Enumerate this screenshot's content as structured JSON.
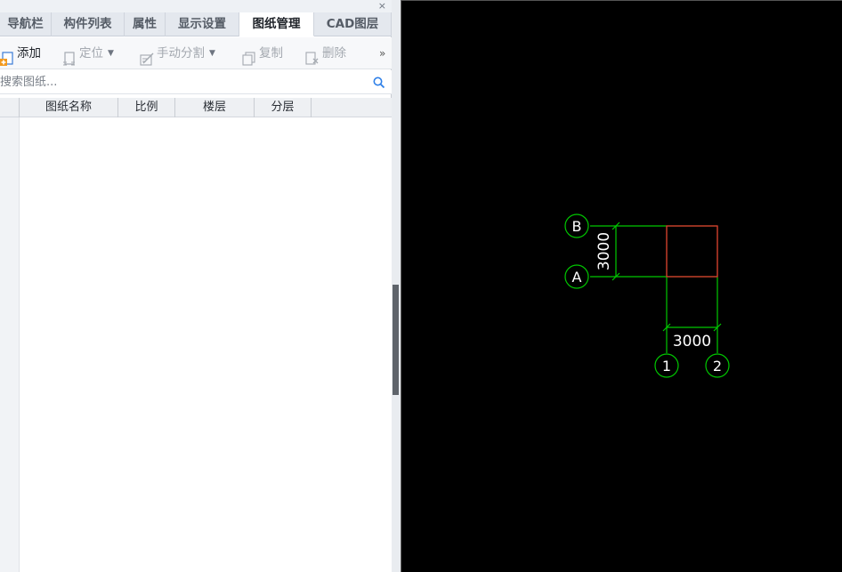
{
  "panel": {
    "close_glyph": "×",
    "tabs": [
      {
        "label": "导航栏",
        "active": false
      },
      {
        "label": "构件列表",
        "active": false
      },
      {
        "label": "属性",
        "active": false
      },
      {
        "label": "显示设置",
        "active": false
      },
      {
        "label": "图纸管理",
        "active": true
      },
      {
        "label": "CAD图层",
        "active": false
      }
    ],
    "toolbar": {
      "add": {
        "label": "添加",
        "icon": "add-drawing-icon",
        "enabled": true
      },
      "locate": {
        "label": "定位",
        "icon": "locate-icon",
        "enabled": false,
        "dropdown": true
      },
      "split": {
        "label": "手动分割",
        "icon": "manual-split-icon",
        "enabled": false,
        "dropdown": true
      },
      "copy": {
        "label": "复制",
        "icon": "copy-icon",
        "enabled": false
      },
      "delete": {
        "label": "删除",
        "icon": "delete-icon",
        "enabled": false
      },
      "more": {
        "glyph": "»",
        "icon": "more-icon"
      }
    },
    "search": {
      "placeholder": "搜索图纸...",
      "value": "",
      "icon": "search-icon"
    },
    "columns": [
      "图纸名称",
      "比例",
      "楼层",
      "分层"
    ],
    "rows": []
  },
  "canvas": {
    "background": "#000000",
    "colors": {
      "axis": "#00c800",
      "highlight": "#e03030",
      "text": "#ffffff"
    },
    "grid_axes": {
      "horizontal": [
        "A",
        "B"
      ],
      "vertical": [
        "1",
        "2"
      ]
    },
    "dimensions": {
      "vertical": "3000",
      "horizontal": "3000"
    }
  }
}
